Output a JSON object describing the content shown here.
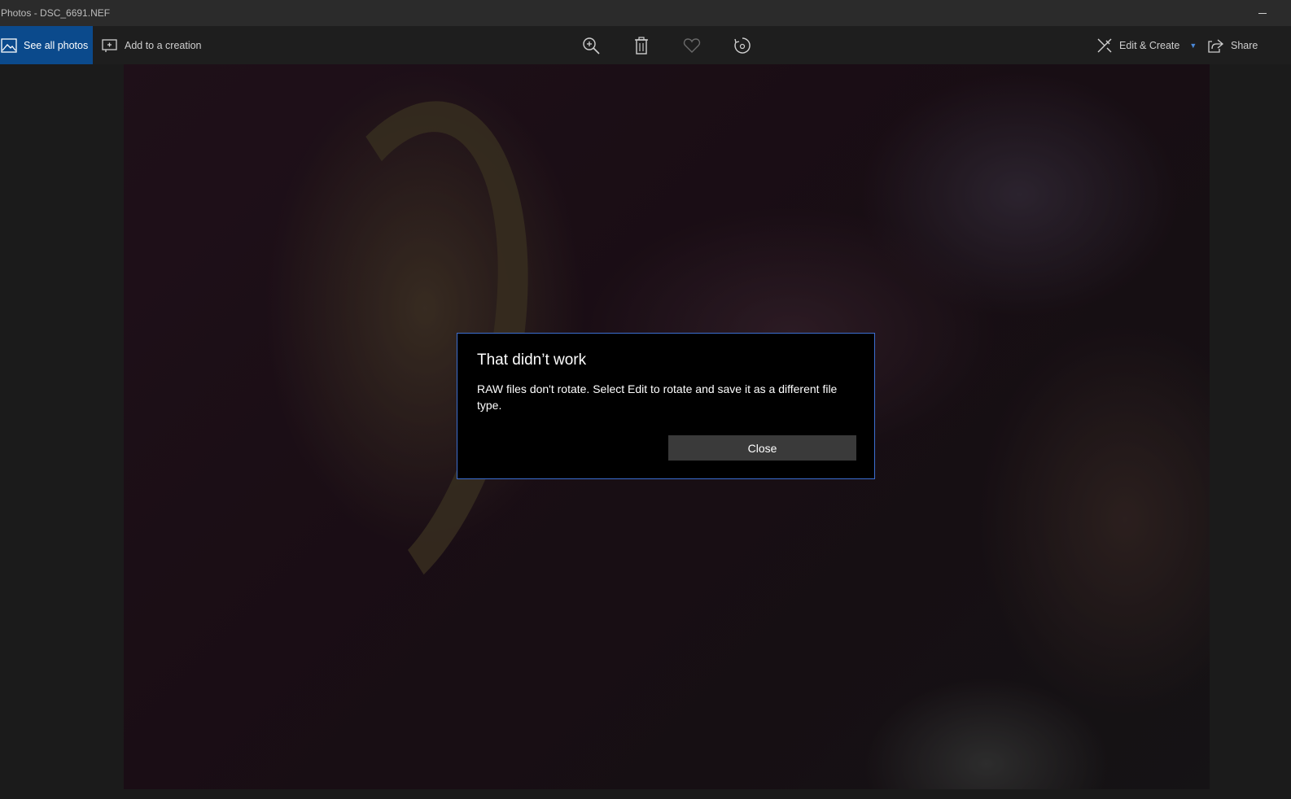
{
  "window": {
    "title": "Photos - DSC_6691.NEF"
  },
  "toolbar": {
    "see_all_photos": "See all photos",
    "add_to_creation": "Add to a creation",
    "edit_create": "Edit & Create",
    "share": "Share",
    "center_icons": [
      "zoom-in-icon",
      "delete-icon",
      "heart-icon",
      "rotate-icon"
    ]
  },
  "dialog": {
    "title": "That didn’t work",
    "message": "RAW files don't rotate. Select Edit to rotate and save it as a different file type.",
    "close_label": "Close"
  },
  "colors": {
    "accent": "#0b4a8c",
    "dialog_border": "#3d6fd1",
    "dialog_bg": "#000000",
    "button_bg": "#3a3a3a"
  }
}
